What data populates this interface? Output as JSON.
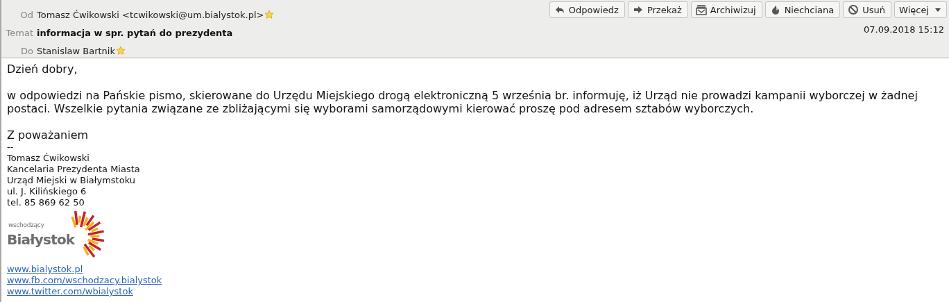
{
  "header": {
    "fields": [
      {
        "label": "Od",
        "value": "Tomasz Ćwikowski <tcwikowski@um.bialystok.pl>",
        "kind": "address"
      },
      {
        "label": "Temat",
        "value": "informacja w spr. pytań do prezydenta",
        "kind": "subject"
      },
      {
        "label": "Do",
        "value": "Stanislaw Bartnik",
        "kind": "address"
      }
    ],
    "buttons": [
      {
        "label": "Odpowiedz",
        "kind": "reply"
      },
      {
        "label": "Przekaż",
        "kind": "forward"
      },
      {
        "label": "Archiwizuj",
        "kind": "archive"
      },
      {
        "label": "Niechciana",
        "kind": "junk"
      },
      {
        "label": "Usuń",
        "kind": "delete"
      },
      {
        "label": "Więcej",
        "kind": "dropdown"
      }
    ],
    "date": "07.09.2018 15:12"
  },
  "body": {
    "greeting": "Dzień dobry,",
    "paragraph": "w odpowiedzi na Pańskie pismo, skierowane do Urzędu Miejskiego drogą elektroniczną 5 września br. informuję, iż Urząd nie prowadzi kampanii wyborczej w żadnej postaci. Wszelkie pytania związane ze zbliżającymi się wyborami samorządowymi kierować proszę pod adresem sztabów wyborczych.",
    "closing": "Z poważaniem",
    "signature_separator": "--",
    "signature_lines": [
      "Tomasz Ćwikowski",
      "Kancelaria Prezydenta Miasta",
      "Urząd Miejski w Białymstoku",
      "ul. J. Kilińskiego 6",
      "tel. 85 869 62 50"
    ],
    "logo": {
      "small_text": "wschodzący",
      "big_text": "Białystok"
    },
    "links": [
      "www.bialystok.pl",
      "www.fb.com/wschodzacy.bialystok",
      "www.twitter.com/wbialystok"
    ]
  }
}
